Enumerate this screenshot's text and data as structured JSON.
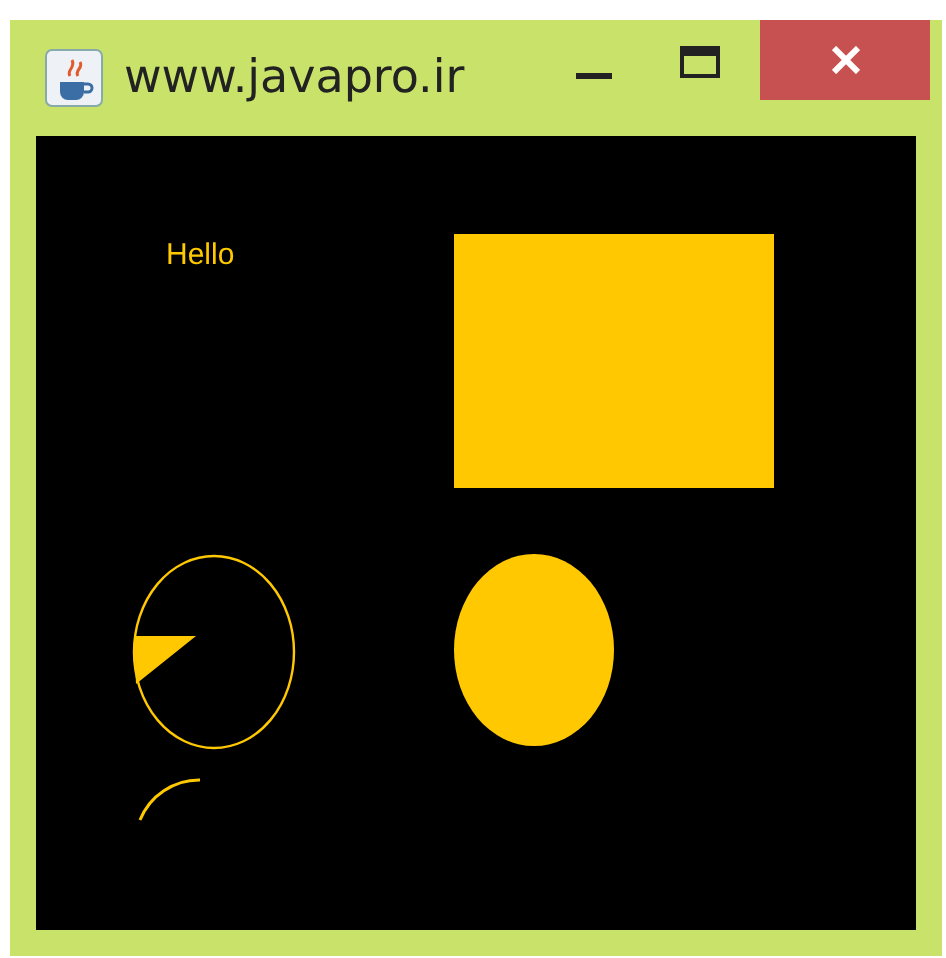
{
  "window": {
    "title": "www.javapro.ir"
  },
  "canvas": {
    "text": "Hello"
  }
}
